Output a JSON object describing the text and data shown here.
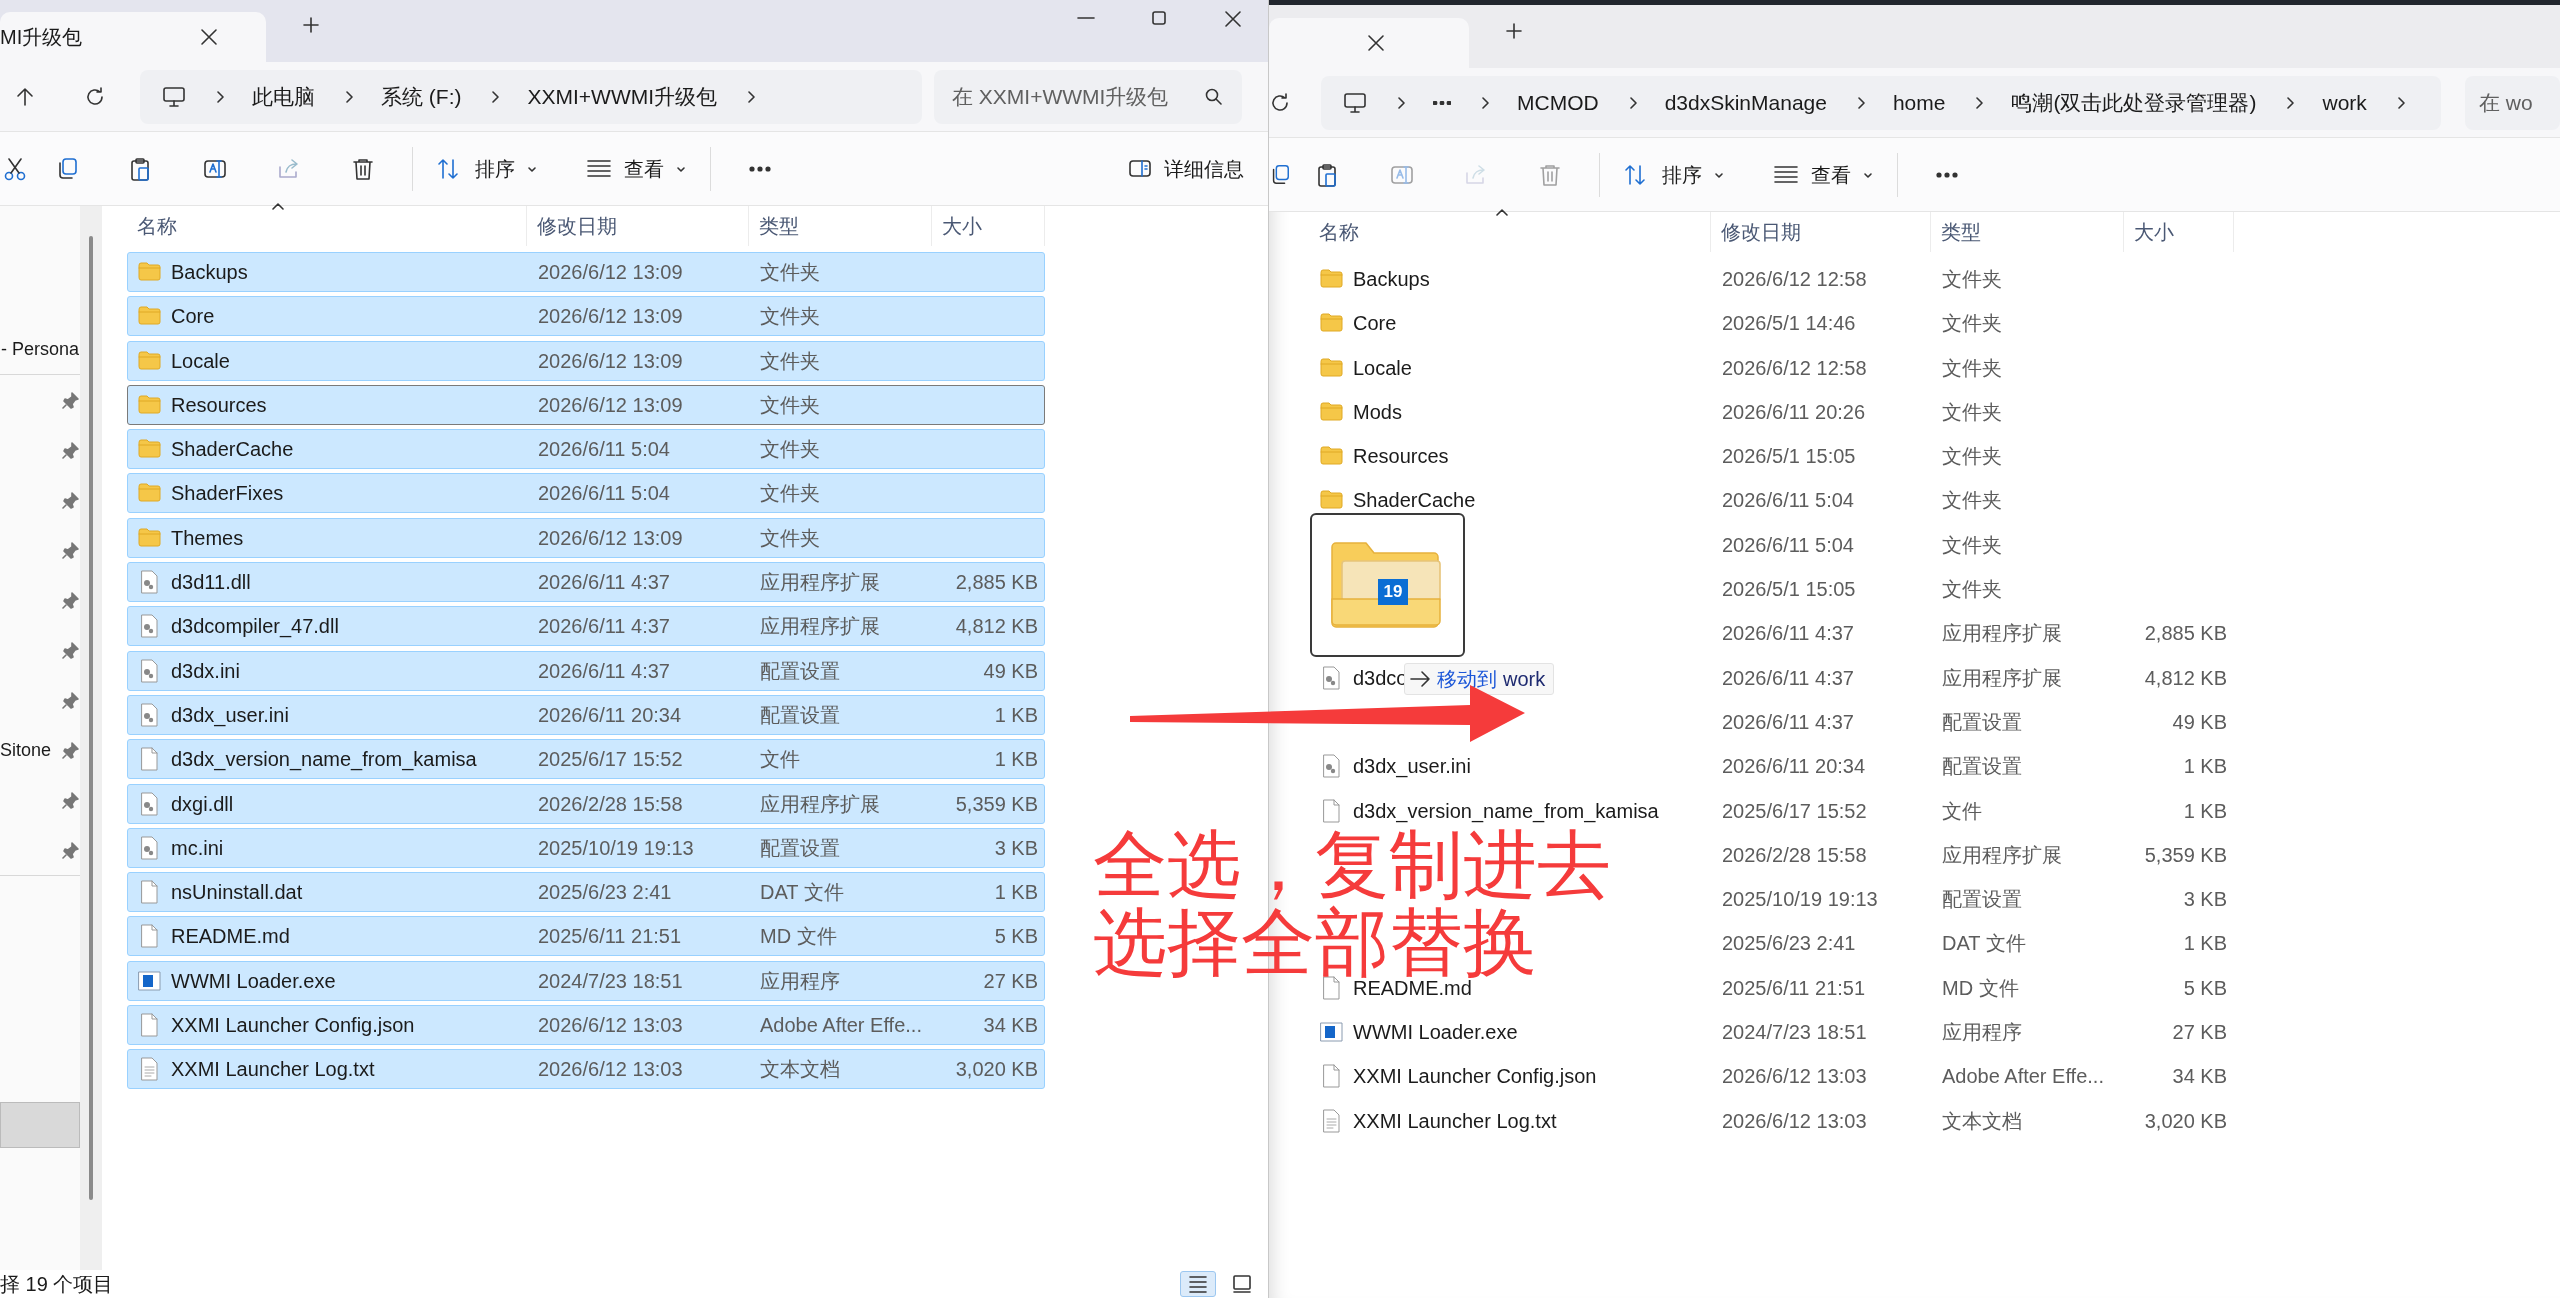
{
  "left_window": {
    "tab": {
      "title": "MI升级包"
    },
    "breadcrumb": [
      "此电脑",
      "系统 (F:)",
      "XXMI+WWMI升级包"
    ],
    "search": {
      "placeholder": "在 XXMI+WWMI升级包"
    },
    "toolbar": {
      "sort": "排序",
      "view": "查看",
      "details": "详细信息"
    },
    "nav_pane": [
      {
        "label": "- Persona",
        "pinned": false
      },
      {
        "pinned": true
      },
      {
        "pinned": true
      },
      {
        "pinned": true
      },
      {
        "pinned": true
      },
      {
        "pinned": true
      },
      {
        "pinned": true
      },
      {
        "pinned": true
      },
      {
        "label": "Sitone",
        "pinned": true
      },
      {
        "pinned": true
      },
      {
        "pinned": true
      }
    ],
    "columns": [
      "名称",
      "修改日期",
      "类型",
      "大小"
    ],
    "rows": [
      {
        "name": "Backups",
        "date": "2026/6/12 13:09",
        "type": "文件夹",
        "kind": "folder",
        "selected": true,
        "focused": false
      },
      {
        "name": "Core",
        "date": "2026/6/12 13:09",
        "type": "文件夹",
        "kind": "folder",
        "selected": true,
        "focused": false
      },
      {
        "name": "Locale",
        "date": "2026/6/12 13:09",
        "type": "文件夹",
        "kind": "folder",
        "selected": true,
        "focused": false
      },
      {
        "name": "Resources",
        "date": "2026/6/12 13:09",
        "type": "文件夹",
        "kind": "folder",
        "selected": true,
        "focused": true
      },
      {
        "name": "ShaderCache",
        "date": "2026/6/11 5:04",
        "type": "文件夹",
        "kind": "folder",
        "selected": true,
        "focused": false
      },
      {
        "name": "ShaderFixes",
        "date": "2026/6/11 5:04",
        "type": "文件夹",
        "kind": "folder",
        "selected": true,
        "focused": false
      },
      {
        "name": "Themes",
        "date": "2026/6/12 13:09",
        "type": "文件夹",
        "kind": "folder",
        "selected": true,
        "focused": false
      },
      {
        "name": "d3d11.dll",
        "date": "2026/6/11 4:37",
        "type": "应用程序扩展",
        "size": "2,885 KB",
        "kind": "gear",
        "selected": true,
        "focused": false
      },
      {
        "name": "d3dcompiler_47.dll",
        "date": "2026/6/11 4:37",
        "type": "应用程序扩展",
        "size": "4,812 KB",
        "kind": "gear",
        "selected": true,
        "focused": false
      },
      {
        "name": "d3dx.ini",
        "date": "2026/6/11 4:37",
        "type": "配置设置",
        "size": "49 KB",
        "kind": "gear",
        "selected": true,
        "focused": false
      },
      {
        "name": "d3dx_user.ini",
        "date": "2026/6/11 20:34",
        "type": "配置设置",
        "size": "1 KB",
        "kind": "gear",
        "selected": true,
        "focused": false
      },
      {
        "name": "d3dx_version_name_from_kamisa",
        "date": "2025/6/17 15:52",
        "type": "文件",
        "size": "1 KB",
        "kind": "file",
        "selected": true,
        "focused": false
      },
      {
        "name": "dxgi.dll",
        "date": "2026/2/28 15:58",
        "type": "应用程序扩展",
        "size": "5,359 KB",
        "kind": "gear",
        "selected": true,
        "focused": false
      },
      {
        "name": "mc.ini",
        "date": "2025/10/19 19:13",
        "type": "配置设置",
        "size": "3 KB",
        "kind": "gear",
        "selected": true,
        "focused": false
      },
      {
        "name": "nsUninstall.dat",
        "date": "2025/6/23 2:41",
        "type": "DAT 文件",
        "size": "1 KB",
        "kind": "file",
        "selected": true,
        "focused": false
      },
      {
        "name": "README.md",
        "date": "2025/6/11 21:51",
        "type": "MD 文件",
        "size": "5 KB",
        "kind": "file",
        "selected": true,
        "focused": false
      },
      {
        "name": "WWMI Loader.exe",
        "date": "2024/7/23 18:51",
        "type": "应用程序",
        "size": "27 KB",
        "kind": "exe",
        "selected": true,
        "focused": false
      },
      {
        "name": "XXMI Launcher Config.json",
        "date": "2026/6/12 13:03",
        "type": "Adobe After Effe...",
        "size": "34 KB",
        "kind": "file",
        "selected": true,
        "focused": false
      },
      {
        "name": "XXMI Launcher Log.txt",
        "date": "2026/6/12 13:03",
        "type": "文本文档",
        "size": "3,020 KB",
        "kind": "text",
        "selected": true,
        "focused": false
      }
    ],
    "status_bar": "择 19 个项目",
    "view_modes": [
      {
        "kind": "details",
        "selected": true
      },
      {
        "kind": "tiles",
        "selected": false
      }
    ]
  },
  "right_window": {
    "breadcrumb": [
      "MCMOD",
      "d3dxSkinManage",
      "home",
      "鸣潮(双击此处登录管理器)",
      "work"
    ],
    "search": {
      "placeholder": "在 wo"
    },
    "toolbar": {
      "sort": "排序",
      "view": "查看"
    },
    "columns": [
      "名称",
      "修改日期",
      "类型",
      "大小"
    ],
    "rows": [
      {
        "name": "Backups",
        "date": "2026/6/12 12:58",
        "type": "文件夹",
        "kind": "folder",
        "selected": false
      },
      {
        "name": "Core",
        "date": "2026/5/1 14:46",
        "type": "文件夹",
        "kind": "folder",
        "selected": false
      },
      {
        "name": "Locale",
        "date": "2026/6/12 12:58",
        "type": "文件夹",
        "kind": "folder",
        "selected": false
      },
      {
        "name": "Mods",
        "date": "2026/6/11 20:26",
        "type": "文件夹",
        "kind": "folder",
        "selected": false
      },
      {
        "name": "Resources",
        "date": "2026/5/1 15:05",
        "type": "文件夹",
        "kind": "folder",
        "selected": false
      },
      {
        "name": "ShaderCache",
        "date": "2026/6/11 5:04",
        "type": "文件夹",
        "kind": "folder",
        "selected": false
      },
      {
        "date": "2026/6/11 5:04",
        "type": "文件夹",
        "selected": false
      },
      {
        "date": "2026/5/1 15:05",
        "type": "文件夹",
        "selected": false
      },
      {
        "date": "2026/6/11 4:37",
        "type": "应用程序扩展",
        "size": "2,885 KB",
        "selected": false
      },
      {
        "name": "d3dco",
        "date": "2026/6/11 4:37",
        "type": "应用程序扩展",
        "size": "4,812 KB",
        "kind": "gear",
        "selected": false
      },
      {
        "date": "2026/6/11 4:37",
        "type": "配置设置",
        "size": "49 KB",
        "selected": false
      },
      {
        "name": "d3dx_user.ini",
        "date": "2026/6/11 20:34",
        "type": "配置设置",
        "size": "1 KB",
        "kind": "gear",
        "selected": false
      },
      {
        "name": "d3dx_version_name_from_kamisa",
        "date": "2025/6/17 15:52",
        "type": "文件",
        "size": "1 KB",
        "kind": "file",
        "selected": false
      },
      {
        "date": "2026/2/28 15:58",
        "type": "应用程序扩展",
        "size": "5,359 KB",
        "selected": false
      },
      {
        "date": "2025/10/19 19:13",
        "type": "配置设置",
        "size": "3 KB",
        "selected": false
      },
      {
        "date": "2025/6/23 2:41",
        "type": "DAT 文件",
        "size": "1 KB",
        "selected": false
      },
      {
        "name": "README.md",
        "date": "2025/6/11 21:51",
        "type": "MD 文件",
        "size": "5 KB",
        "kind": "file",
        "selected": false
      },
      {
        "name": "WWMI Loader.exe",
        "date": "2024/7/23 18:51",
        "type": "应用程序",
        "size": "27 KB",
        "kind": "exe",
        "selected": false
      },
      {
        "name": "XXMI Launcher Config.json",
        "date": "2026/6/12 13:03",
        "type": "Adobe After Effe...",
        "size": "34 KB",
        "kind": "file",
        "selected": false
      },
      {
        "name": "XXMI Launcher Log.txt",
        "date": "2026/6/12 13:03",
        "type": "文本文档",
        "size": "3,020 KB",
        "kind": "text",
        "selected": false
      }
    ]
  },
  "drag": {
    "count": "19",
    "action": "移动到",
    "target": "work"
  },
  "annotation": {
    "lines": [
      "全选，复制进去",
      "选择全部替换"
    ]
  }
}
